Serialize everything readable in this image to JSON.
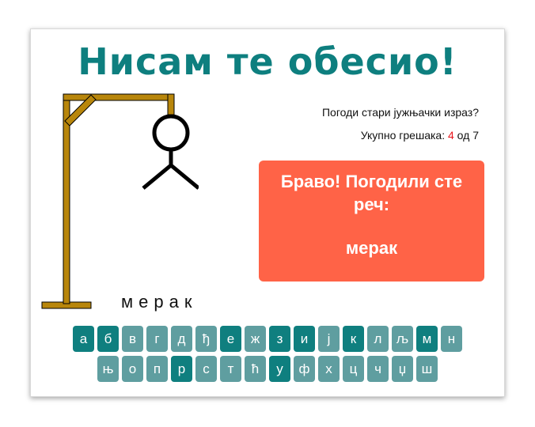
{
  "title": "Нисам те обесио!",
  "hint": "Погоди стари јужњачки израз?",
  "mistakes": {
    "prefix": "Укупно грешака: ",
    "count": "4",
    "suffix": " од 7"
  },
  "result": {
    "message": "Браво! Погодили сте реч:",
    "word": "мерак"
  },
  "guessed_word": "мерак",
  "colors": {
    "title": "#0e7f7f",
    "result_bg": "#ff6347",
    "key_used": "#0f7f7f",
    "key_unused": "#5f9ea0",
    "gallows": "#b8860b",
    "mistake_count": "#e8141b"
  },
  "keyboard": {
    "rows": [
      [
        {
          "letter": "а",
          "used": true
        },
        {
          "letter": "б",
          "used": true
        },
        {
          "letter": "в",
          "used": false
        },
        {
          "letter": "г",
          "used": false
        },
        {
          "letter": "д",
          "used": false
        },
        {
          "letter": "ђ",
          "used": false
        },
        {
          "letter": "е",
          "used": true
        },
        {
          "letter": "ж",
          "used": false
        },
        {
          "letter": "з",
          "used": true
        },
        {
          "letter": "и",
          "used": true
        },
        {
          "letter": "ј",
          "used": false
        },
        {
          "letter": "к",
          "used": true
        },
        {
          "letter": "л",
          "used": false
        },
        {
          "letter": "љ",
          "used": false
        },
        {
          "letter": "м",
          "used": true
        },
        {
          "letter": "н",
          "used": false
        }
      ],
      [
        {
          "letter": "њ",
          "used": false
        },
        {
          "letter": "о",
          "used": false
        },
        {
          "letter": "п",
          "used": false
        },
        {
          "letter": "р",
          "used": true
        },
        {
          "letter": "с",
          "used": false
        },
        {
          "letter": "т",
          "used": false
        },
        {
          "letter": "ћ",
          "used": false
        },
        {
          "letter": "у",
          "used": true
        },
        {
          "letter": "ф",
          "used": false
        },
        {
          "letter": "х",
          "used": false
        },
        {
          "letter": "ц",
          "used": false
        },
        {
          "letter": "ч",
          "used": false
        },
        {
          "letter": "џ",
          "used": false
        },
        {
          "letter": "ш",
          "used": false
        }
      ]
    ]
  }
}
